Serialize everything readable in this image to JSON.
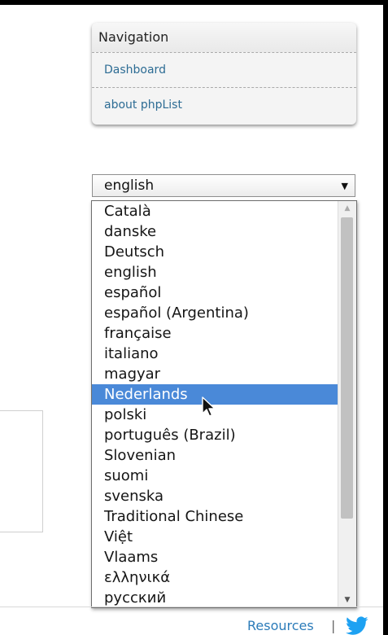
{
  "navigation": {
    "title": "Navigation",
    "items": [
      {
        "label": "Dashboard"
      },
      {
        "label": "about phpList"
      }
    ]
  },
  "language_select": {
    "selected_value": "english",
    "highlighted_option": "Nederlands",
    "options": [
      "Català",
      "danske",
      "Deutsch",
      "english",
      "español",
      "español (Argentina)",
      "française",
      "italiano",
      "magyar",
      "Nederlands",
      "polski",
      "português (Brazil)",
      "Slovenian",
      "suomi",
      "svenska",
      "Traditional Chinese",
      "Việt",
      "Vlaams",
      "ελληνικά",
      "русский"
    ]
  },
  "footer": {
    "resources_label": "Resources",
    "separator": "|",
    "social_icon": "twitter-icon"
  },
  "colors": {
    "link": "#2d6c94",
    "highlight": "#4a89d8",
    "twitter": "#1da1f2"
  }
}
